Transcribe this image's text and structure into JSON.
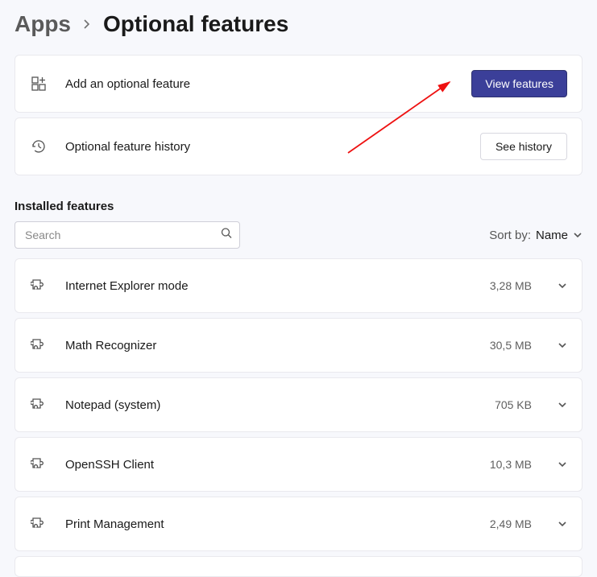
{
  "breadcrumb": {
    "apps": "Apps",
    "title": "Optional features"
  },
  "add_card": {
    "label": "Add an optional feature",
    "button": "View features"
  },
  "history_card": {
    "label": "Optional feature history",
    "button": "See history"
  },
  "installed": {
    "section_title": "Installed features",
    "search_placeholder": "Search",
    "sort_label": "Sort by:",
    "sort_value": "Name",
    "items": [
      {
        "name": "Internet Explorer mode",
        "size": "3,28 MB"
      },
      {
        "name": "Math Recognizer",
        "size": "30,5 MB"
      },
      {
        "name": "Notepad (system)",
        "size": "705 KB"
      },
      {
        "name": "OpenSSH Client",
        "size": "10,3 MB"
      },
      {
        "name": "Print Management",
        "size": "2,49 MB"
      }
    ]
  }
}
